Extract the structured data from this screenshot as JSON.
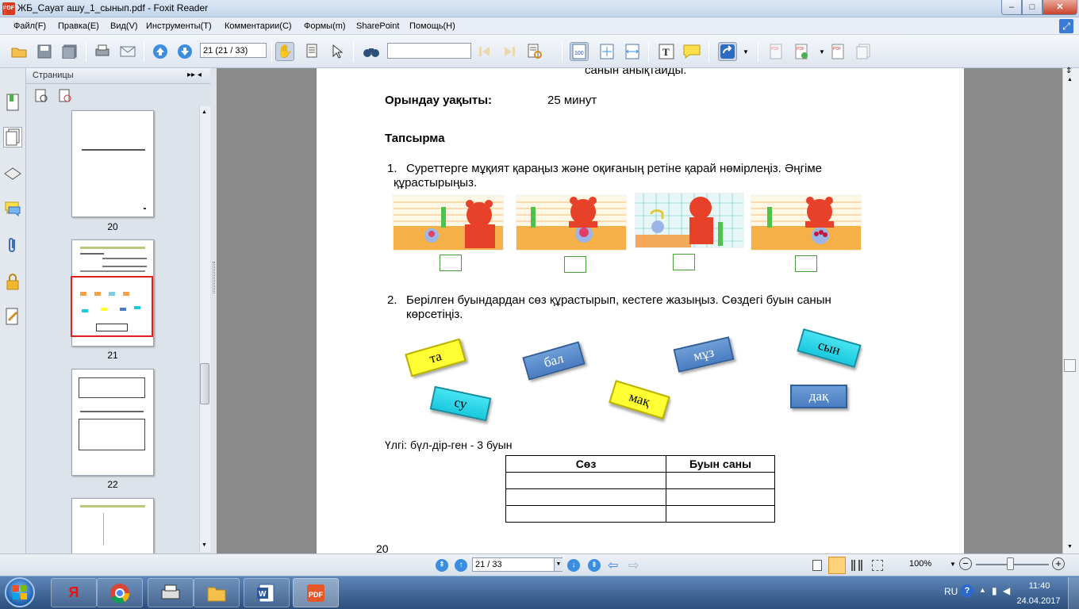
{
  "window": {
    "title": "ЖБ_Сауат ашу_1_сынып.pdf - Foxit Reader",
    "app_icon_text": "PDF",
    "min_symbol": "–",
    "max_symbol": "□",
    "close_symbol": "✕"
  },
  "menu": [
    "Файл(F)",
    "Правка(E)",
    "Вид(V)",
    "Инструменты(T)",
    "Комментарии(C)",
    "Формы(m)",
    "SharePoint",
    "Помощь(H)"
  ],
  "toolbar": {
    "page_field": "21 (21 / 33)",
    "find_field": ""
  },
  "left_panel": {
    "title": "Страницы",
    "expand_symbol": "▸▸ ◂",
    "thumbnails": [
      {
        "label": "20"
      },
      {
        "label": "21"
      },
      {
        "label": "22"
      }
    ]
  },
  "document": {
    "top_line": "санын анықтайды.",
    "time_label": "Орындау уақыты:",
    "time_value": "25 минут",
    "task_heading": "Тапсырма",
    "task1_num": "1.",
    "task1_line1": "Суреттерге  мұқият  қараңыз  және  оқиғаның  ретіне  қарай  нөмірлеңіз.  Әңгіме",
    "task1_line2": "құрастырыңыз.",
    "task2_num": "2.",
    "task2_line1": "Берілген буындардан сөз құрастырып, кестеге жазыңыз. Сөздегі буын санын",
    "task2_line2": "көрсетіңіз.",
    "syllables": [
      "та",
      "бал",
      "мұз",
      "сын",
      "су",
      "мақ",
      "дақ"
    ],
    "example": "Үлгі:  бүл-дір-ген - 3 буын",
    "table_headers": [
      "Сөз",
      "Буын саны"
    ],
    "page_number": "20"
  },
  "status": {
    "page_field": "21 / 33",
    "zoom": "100%"
  },
  "tray": {
    "lang": "RU",
    "time": "11:40",
    "date": "24.04.2017"
  },
  "colors": {
    "answer_box": "#4a9e3a",
    "syl_yellow": "#ffff33",
    "syl_blue": "#4a7dc2",
    "syl_cyan": "#19c9de",
    "highlight_thumb": "#e0201a"
  }
}
